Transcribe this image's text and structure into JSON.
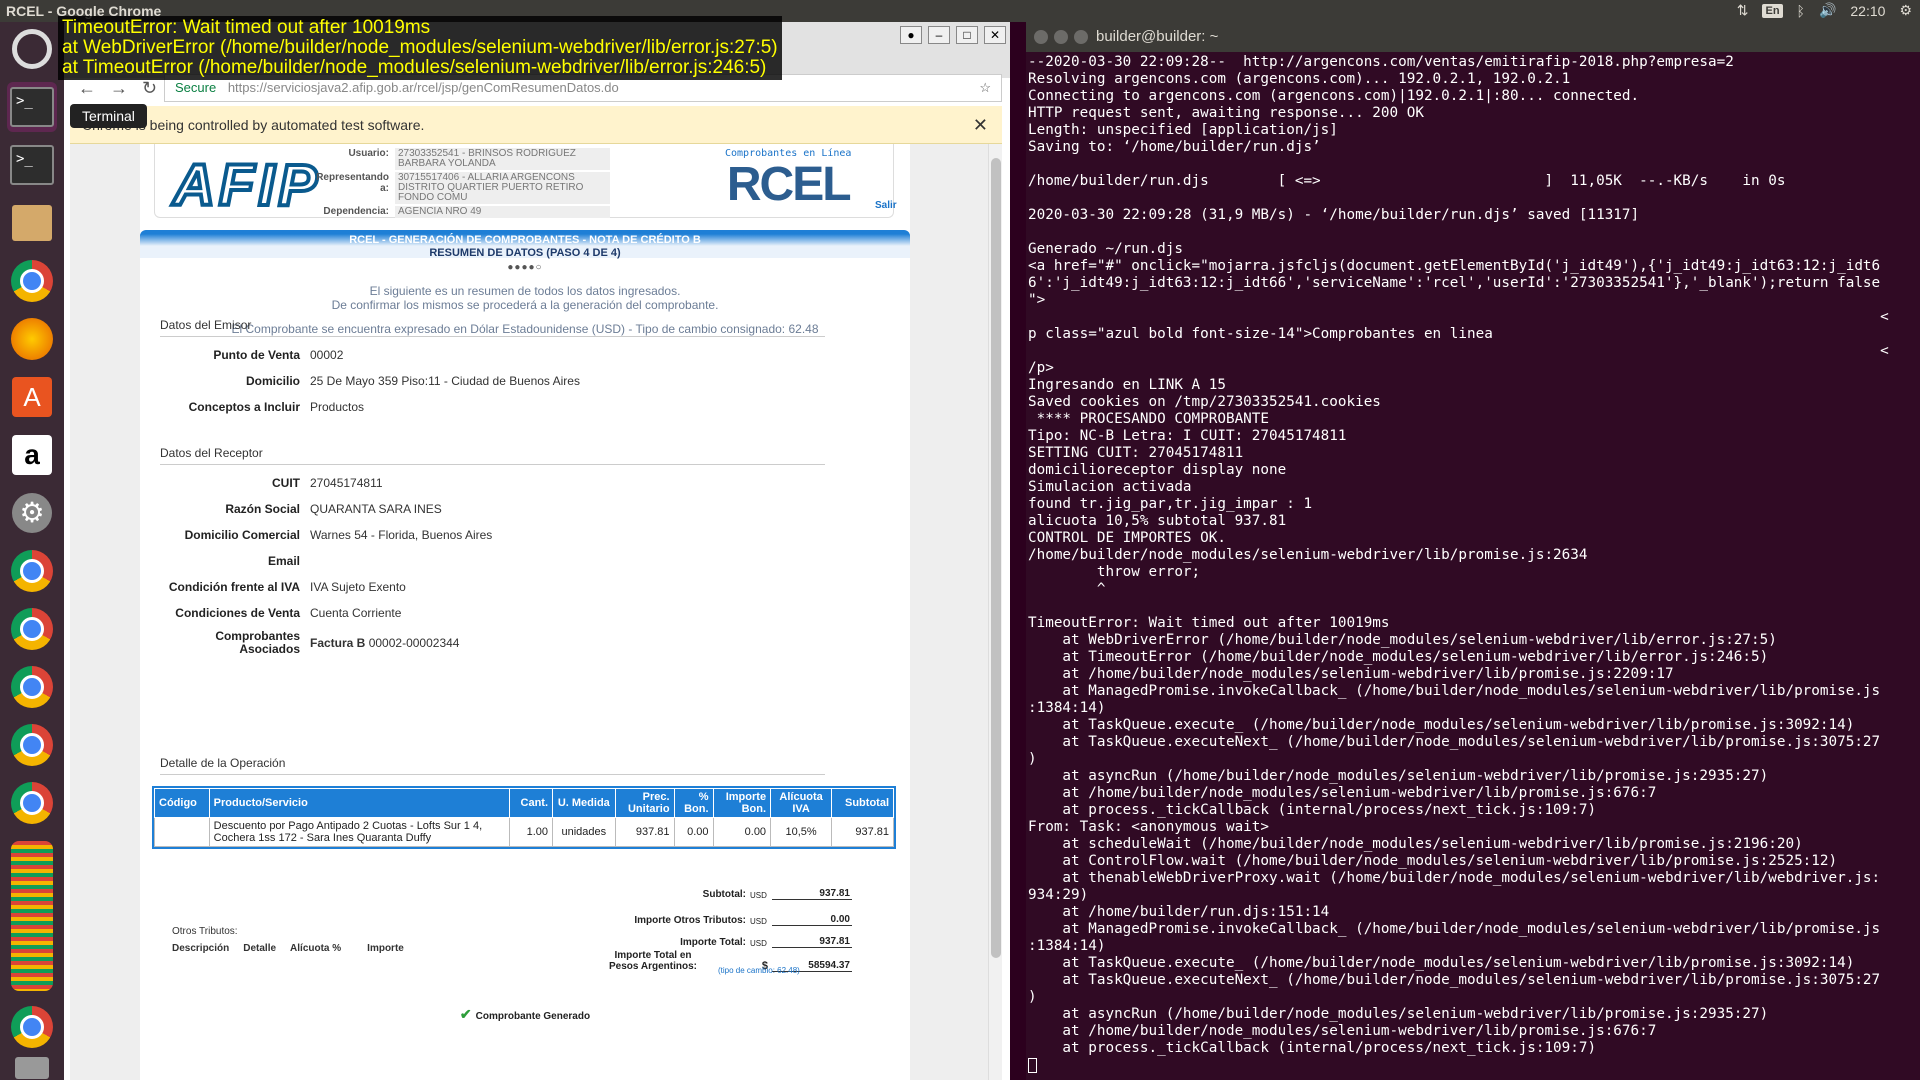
{
  "topbar": {
    "title": "RCEL - Google Chrome",
    "keyboard": "En",
    "time": "22:10"
  },
  "launcher": {
    "tooltip": "Terminal"
  },
  "overlay_error": [
    "TimeoutError: Wait timed out after 10019ms",
    "    at WebDriverError (/home/builder/node_modules/selenium-webdriver/lib/error.js:27:5)",
    "    at TimeoutError (/home/builder/node_modules/selenium-webdriver/lib/error.js:246:5)"
  ],
  "browser": {
    "secure_label": "Secure",
    "url": "https://serviciosjava2.afip.gob.ar/rcel/jsp/genComResumenDatos.do",
    "infobar": "Chrome is being controlled by automated test software."
  },
  "header": {
    "logo": "AFIP",
    "usuario_label": "Usuario:",
    "usuario": "27303352541 - BRINSOS RODRIGUEZ BARBARA YOLANDA",
    "representado_label": "Representando a:",
    "representado": "30715517406 - ALLARIA ARGENCONS DISTRITO QUARTIER PUERTO RETIRO FONDO COMU",
    "dependencia_label": "Dependencia:",
    "dependencia": "AGENCIA NRO 49",
    "rcel_sub": "Comprobantes en Línea",
    "rcel": "RCEL",
    "salir": "Salir"
  },
  "banner": {
    "line1": "RCEL - GENERACIÓN DE COMPROBANTES - NOTA DE CRÉDITO B",
    "line2": "RESUMEN DE DATOS (PASO 4 DE 4)",
    "steps": "●●●●○"
  },
  "intro": {
    "line1": "El siguiente es un resumen de todos los datos ingresados.",
    "line2": "De confirmar los mismos se procederá a la generación del comprobante.",
    "note": "El Comprobante se encuentra expresado en Dólar Estadounidense (USD) - Tipo de cambio consignado: 62.48"
  },
  "emisor": {
    "title": "Datos del Emisor",
    "rows": [
      {
        "k": "Punto de Venta",
        "v": "00002"
      },
      {
        "k": "Domicilio",
        "v": "25 De Mayo 359 Piso:11 - Ciudad de Buenos Aires"
      },
      {
        "k": "Conceptos a Incluir",
        "v": "Productos"
      }
    ]
  },
  "receptor": {
    "title": "Datos del Receptor",
    "rows": [
      {
        "k": "CUIT",
        "v": "27045174811"
      },
      {
        "k": "Razón Social",
        "v": "QUARANTA SARA INES"
      },
      {
        "k": "Domicilio Comercial",
        "v": "Warnes 54 - Florida, Buenos Aires"
      },
      {
        "k": "Email",
        "v": ""
      },
      {
        "k": "Condición frente al IVA",
        "v": "IVA Sujeto Exento"
      },
      {
        "k": "Condiciones de Venta",
        "v": "Cuenta Corriente"
      }
    ],
    "asociados_k1": "Comprobantes",
    "asociados_k2": "Asociados",
    "asociados_bold": "Factura B",
    "asociados_v": "00002-00002344"
  },
  "detalle": {
    "title": "Detalle de la Operación",
    "headers": [
      "Código",
      "Producto/Servicio",
      "Cant.",
      "U. Medida",
      "Prec. Unitario",
      "% Bon.",
      "Importe Bon.",
      "Alícuota IVA",
      "Subtotal"
    ],
    "row": [
      "",
      "Descuento por Pago Antipado 2 Cuotas - Lofts Sur 1 4, Cochera 1ss 172 - Sara Ines Quaranta Duffy",
      "1.00",
      "unidades",
      "937.81",
      "0.00",
      "0.00",
      "10,5%",
      "937.81"
    ]
  },
  "totals": {
    "subtotal_k": "Subtotal:",
    "subtotal_cur": "USD",
    "subtotal_v": "937.81",
    "otros_k": "Importe Otros Tributos:",
    "otros_cur": "USD",
    "otros_v": "0.00",
    "total_k": "Importe Total:",
    "total_cur": "USD",
    "total_v": "937.81",
    "pesos_k1": "Importe Total en",
    "pesos_k2": "Pesos Argentinos:",
    "pesos_cur": "$",
    "pesos_v": "58594.37",
    "tc": "(tipo de cambio: 62.48)"
  },
  "otros_tributos": {
    "title": "Otros Tributos:",
    "cols": [
      "Descripción",
      "Detalle",
      "Alícuota %",
      "Importe"
    ]
  },
  "generado": "Comprobante Generado",
  "terminal": {
    "title": "builder@builder: ~",
    "text": "--2020-03-30 22:09:28--  http://argencons.com/ventas/emitirafip-2018.php?empresa=2\nResolving argencons.com (argencons.com)... 192.0.2.1, 192.0.2.1\nConnecting to argencons.com (argencons.com)|192.0.2.1|:80... connected.\nHTTP request sent, awaiting response... 200 OK\nLength: unspecified [application/js]\nSaving to: ‘/home/builder/run.djs’\n\n/home/builder/run.djs        [ <=>                          ]  11,05K  --.-KB/s    in 0s\n\n2020-03-30 22:09:28 (31,9 MB/s) - ‘/home/builder/run.djs’ saved [11317]\n\nGenerado ~/run.djs\n<a href=\"#\" onclick=\"mojarra.jsfcljs(document.getElementById('j_idt49'),{'j_idt49:j_idt63:12:j_idt6\n6':'j_idt49:j_idt63:12:j_idt66','serviceName':'rcel','userId':'27303352541'},'_blank');return false\n\">\n                                                                                                   <\np class=\"azul bold font-size-14\">Comprobantes en linea\n                                                                                                   <\n/p>\nIngresando en LINK A 15\nSaved cookies on /tmp/27303352541.cookies\n **** PROCESANDO COMPROBANTE\nTipo: NC-B Letra: I CUIT: 27045174811\nSETTING CUIT: 27045174811\ndomicilioreceptor display none\nSimulacion activada\nfound tr.jig_par,tr.jig_impar : 1\nalicuota 10,5% subtotal 937.81\nCONTROL DE IMPORTES OK.\n/home/builder/node_modules/selenium-webdriver/lib/promise.js:2634\n        throw error;\n        ^\n\nTimeoutError: Wait timed out after 10019ms\n    at WebDriverError (/home/builder/node_modules/selenium-webdriver/lib/error.js:27:5)\n    at TimeoutError (/home/builder/node_modules/selenium-webdriver/lib/error.js:246:5)\n    at /home/builder/node_modules/selenium-webdriver/lib/promise.js:2209:17\n    at ManagedPromise.invokeCallback_ (/home/builder/node_modules/selenium-webdriver/lib/promise.js\n:1384:14)\n    at TaskQueue.execute_ (/home/builder/node_modules/selenium-webdriver/lib/promise.js:3092:14)\n    at TaskQueue.executeNext_ (/home/builder/node_modules/selenium-webdriver/lib/promise.js:3075:27\n)\n    at asyncRun (/home/builder/node_modules/selenium-webdriver/lib/promise.js:2935:27)\n    at /home/builder/node_modules/selenium-webdriver/lib/promise.js:676:7\n    at process._tickCallback (internal/process/next_tick.js:109:7)\nFrom: Task: <anonymous wait>\n    at scheduleWait (/home/builder/node_modules/selenium-webdriver/lib/promise.js:2196:20)\n    at ControlFlow.wait (/home/builder/node_modules/selenium-webdriver/lib/promise.js:2525:12)\n    at thenableWebDriverProxy.wait (/home/builder/node_modules/selenium-webdriver/lib/webdriver.js:\n934:29)\n    at /home/builder/run.djs:151:14\n    at ManagedPromise.invokeCallback_ (/home/builder/node_modules/selenium-webdriver/lib/promise.js\n:1384:14)\n    at TaskQueue.execute_ (/home/builder/node_modules/selenium-webdriver/lib/promise.js:3092:14)\n    at TaskQueue.executeNext_ (/home/builder/node_modules/selenium-webdriver/lib/promise.js:3075:27\n)\n    at asyncRun (/home/builder/node_modules/selenium-webdriver/lib/promise.js:2935:27)\n    at /home/builder/node_modules/selenium-webdriver/lib/promise.js:676:7\n    at process._tickCallback (internal/process/next_tick.js:109:7)"
  }
}
